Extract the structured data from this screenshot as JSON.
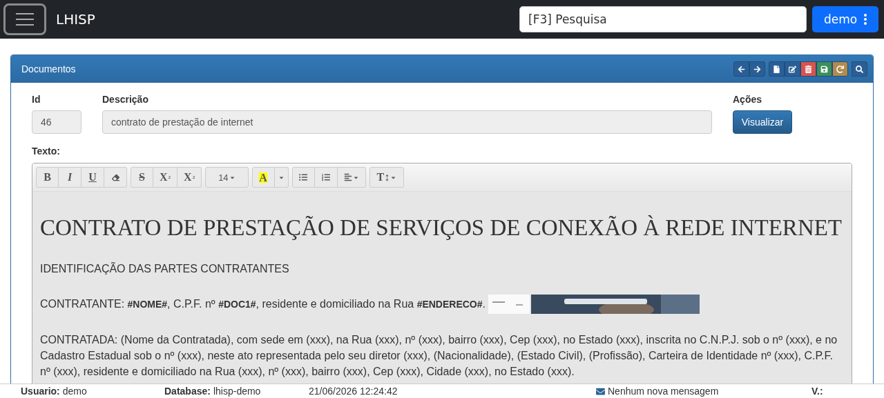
{
  "navbar": {
    "brand": "LHISP",
    "search": {
      "placeholder": "[F3] Pesquisa"
    },
    "user_button": "demo"
  },
  "panel": {
    "title": "Documentos",
    "tool_groups": [
      [
        {
          "kind": "left",
          "color": "#2a5f96"
        },
        {
          "kind": "right",
          "color": "#2a5f96"
        }
      ],
      [
        {
          "kind": "new",
          "color": "#2a5f96"
        },
        {
          "kind": "edit",
          "color": "#2a5f96"
        },
        {
          "kind": "delete",
          "color": "#d9534f"
        },
        {
          "kind": "save",
          "color": "#3c8f5c"
        },
        {
          "kind": "reload",
          "color": "#b08c4e"
        }
      ],
      [
        {
          "kind": "search",
          "color": "#2a5f96"
        }
      ]
    ],
    "fields": {
      "id_label": "Id",
      "id_value": "46",
      "description_label": "Descrição",
      "description_value": "contrato de prestação de internet",
      "actions_label": "Ações",
      "view_button": "Visualizar",
      "text_label": "Texto:"
    },
    "editor": {
      "toolbar": [
        [
          {
            "kind": "bold",
            "label": "B"
          },
          {
            "kind": "italic",
            "label": "I"
          },
          {
            "kind": "underline",
            "label": "U"
          },
          {
            "kind": "eraser"
          }
        ],
        [
          {
            "kind": "strike",
            "label": "S"
          },
          {
            "kind": "sup",
            "label": "X",
            "mark": "2"
          },
          {
            "kind": "sub",
            "label": "X",
            "mark": "2"
          }
        ],
        [
          {
            "kind": "fontsize",
            "label": "14"
          }
        ],
        [
          {
            "kind": "color",
            "label": "A"
          },
          {
            "kind": "caret"
          }
        ],
        [
          {
            "kind": "ul"
          },
          {
            "kind": "ol"
          },
          {
            "kind": "align"
          }
        ],
        [
          {
            "kind": "height",
            "label": "T",
            "mark": "↕"
          }
        ]
      ],
      "content": [
        {
          "kind": "heading",
          "text": "CONTRATO DE PRESTAÇÃO DE SERVIÇOS DE CONEXÃO À REDE INTERNET"
        },
        {
          "kind": "paragraph",
          "text": "IDENTIFICAÇÃO DAS PARTES CONTRATANTES"
        },
        {
          "kind": "paragraph_picture",
          "text": "CONTRATANTE: **#NOME#**, C.P.F. nº **#DOC1#**, residente e domiciliado na Rua **#ENDERECO#**."
        },
        {
          "kind": "paragraph",
          "text": "CONTRATADA: (Nome da Contratada), com sede em (xxx), na Rua (xxx), nº (xxx), bairro (xxx), Cep (xxx), no Estado (xxx), inscrita no C.N.P.J. sob o nº (xxx), e no Cadastro Estadual sob o nº (xxx), neste ato representada pelo seu diretor (xxx), (Nacionalidade), (Estado Civil), (Profissão), Carteira de Identidade nº (xxx), C.P.F. nº (xxx), residente e domiciliado na Rua (xxx), nº (xxx), bairro (xxx), Cep (xxx), Cidade (xxx), no Estado (xxx)."
        }
      ]
    }
  },
  "status_bar": {
    "user_label": "Usuario:",
    "user": "demo",
    "db_label": "Database:",
    "db": "lhisp-demo",
    "datetime": "21/06/2026 12:24:42",
    "messages": "Nenhum nova mensagem",
    "version_label": "V.:"
  }
}
